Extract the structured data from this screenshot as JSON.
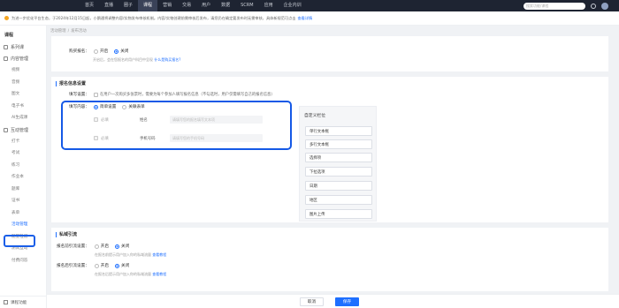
{
  "topbar": {
    "nav": [
      "首页",
      "直播",
      "圈子",
      "课程",
      "营销",
      "交易",
      "用户",
      "数据",
      "SCRM",
      "应用",
      "企业内训"
    ],
    "active_nav": "课程",
    "search_placeholder": "搜索功能/课程"
  },
  "notice": {
    "text": "为进一步优化平台生态，于2024年12月15日起，小鹅通将调整内容/实物发布审核机制。内容/实物创建前需审核后发布，请您仍在确定要发布时无需审核，具体新规范可点击",
    "link": "查看详情"
  },
  "sidebar": {
    "title": "课程",
    "groups": [
      {
        "label": "系列课",
        "items": []
      },
      {
        "label": "内容管理",
        "items": [
          "视频",
          "音频",
          "图文",
          "电子书",
          "AI生成课"
        ]
      },
      {
        "label": "互动管理",
        "items": [
          "打卡",
          "考试",
          "练习",
          "作业本",
          "题库",
          "证书",
          "表单",
          "活动管理",
          "随堂检测",
          "测试互动",
          "付费问答"
        ]
      }
    ],
    "active_item": "活动管理",
    "bottom": "课程功能"
  },
  "breadcrumb": [
    "活动管理",
    "发布活动"
  ],
  "section1": {
    "label": "购买报名：",
    "opt_on": "开启",
    "opt_off": "关闭",
    "hint": "开启后，会在您报名的用户科目中呈现",
    "hint_link": "什么是购买报名?"
  },
  "section2": {
    "title": "报名信息设置",
    "write_label": "填写设置：",
    "write_option": "在用户一次购买多张票时，需要为每个参加人填写报名信息（不勾选时，用户仅需填写自己的报名信息）",
    "content_label": "填写内容：",
    "tab_selected": "简单设置",
    "tab_other": "关联表单",
    "fields": [
      {
        "check": "必填",
        "name": "姓名",
        "placeholder": "请填写您的报名填写文本项"
      },
      {
        "check": "必填",
        "name": "手机号码",
        "placeholder": "请填写您的手机号码"
      }
    ]
  },
  "custom_panel": {
    "title": "自定义栏位",
    "buttons": [
      "单行文本框",
      "多行文本框",
      "选择项",
      "下拉选项",
      "日期",
      "地区",
      "图片上传"
    ]
  },
  "section3": {
    "title": "私域引流",
    "row1_label": "报名前引流设置：",
    "row1_hint": "在报名前提示用户加入你的私域流量",
    "row2_label": "报名后引流设置：",
    "row2_hint": "在报名后提示用户加入你的私域流量",
    "hint_link": "查看教程",
    "opt_on": "开启",
    "opt_off": "关闭"
  },
  "footer": {
    "cancel": "取消",
    "save": "保存"
  }
}
